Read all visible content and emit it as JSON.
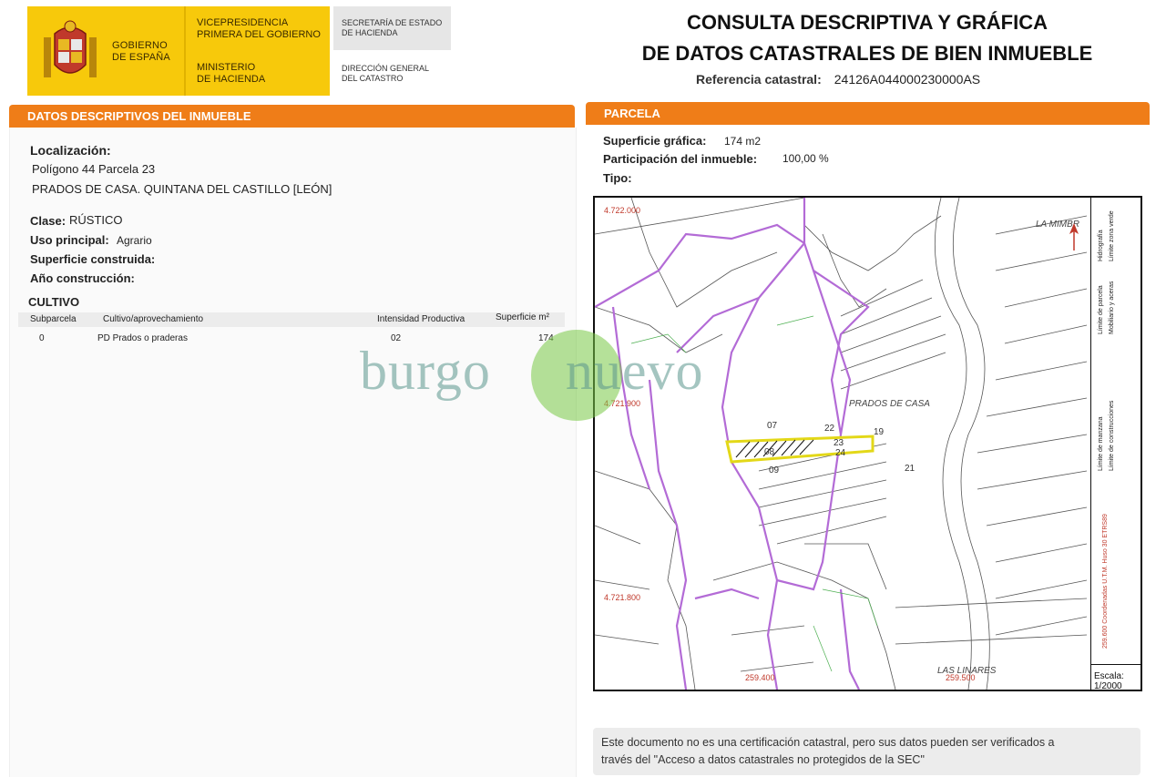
{
  "header": {
    "gov_name": [
      "GOBIERNO",
      "DE ESPAÑA"
    ],
    "vicepresidencia": [
      "VICEPRESIDENCIA",
      "PRIMERA DEL GOBIERNO"
    ],
    "ministerio": [
      "MINISTERIO",
      "DE HACIENDA"
    ],
    "secretaria": [
      "SECRETARÍA DE ESTADO",
      "DE HACIENDA"
    ],
    "direccion": [
      "DIRECCIÓN GENERAL",
      "DEL CATASTRO"
    ],
    "title_line1": "CONSULTA DESCRIPTIVA Y GRÁFICA",
    "title_line2": "DE DATOS CATASTRALES DE BIEN INMUEBLE",
    "ref_label": "Referencia catastral:",
    "ref_value": "24126A044000230000AS"
  },
  "left": {
    "section_title": "DATOS DESCRIPTIVOS DEL INMUEBLE",
    "localizacion_label": "Localización:",
    "localizacion_line1": "Polígono 44 Parcela 23",
    "localizacion_line2": "PRADOS DE CASA. QUINTANA DEL CASTILLO [LEÓN]",
    "clase_label": "Clase:",
    "clase_value": "RÚSTICO",
    "uso_label": "Uso principal:",
    "uso_value": "Agrario",
    "superficie_label": "Superficie construida:",
    "anio_label": "Año construcción:",
    "cultivo_title": "CULTIVO",
    "cultivo_headers": [
      "Subparcela",
      "Cultivo/aprovechamiento",
      "Intensidad Productiva",
      "Superficie m²"
    ],
    "cultivo_rows": [
      [
        "0",
        "PD Prados o praderas",
        "02",
        "174"
      ]
    ]
  },
  "right": {
    "section_title": "PARCELA",
    "superficie_label": "Superficie gráfica:",
    "superficie_value": "174 m2",
    "participacion_label": "Participación del inmueble:",
    "participacion_value": "100,00 %",
    "tipo_label": "Tipo:"
  },
  "map": {
    "labels": {
      "la_mimbre": "LA MIMBR",
      "prados": "PRADOS DE CASA",
      "linares": "LAS LINARES"
    },
    "coords": {
      "n1": "4.722.000",
      "n2": "4.721.900",
      "n3": "4.721.800",
      "e1": "259.400",
      "e2": "259.500"
    },
    "parcels": [
      "07",
      "22",
      "19",
      "23",
      "24",
      "09",
      "21",
      "08"
    ],
    "legend": [
      "Límite de manzana",
      "Límite de parcela",
      "Hidrografía",
      "Límite de construcciones",
      "Mobiliario y aceras",
      "Límite zona verde"
    ],
    "utm_note": "259.600 Coordenadas U.T.M. Huso 30 ETRS89",
    "scale_label": "Escala:",
    "scale_value": "1/2000"
  },
  "watermark": {
    "left": "burgo",
    "right": "nuevo"
  },
  "note": {
    "line1": "Este documento no es una certificación catastral, pero sus datos pueden ser verificados a",
    "line2": "través del \"Acceso a datos catastrales no protegidos de la SEC\""
  }
}
